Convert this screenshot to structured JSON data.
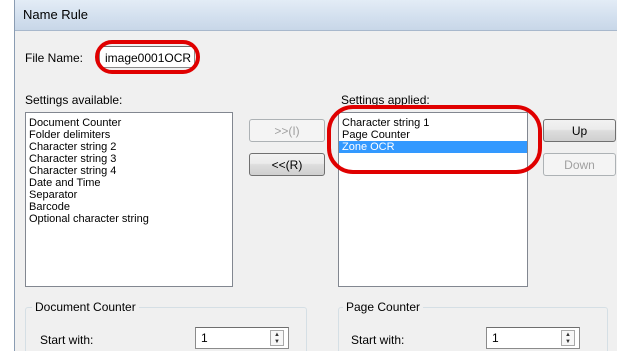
{
  "window": {
    "title": "Name Rule"
  },
  "file_name": {
    "label": "File Name:",
    "value": "image0001OCR"
  },
  "settings_available": {
    "label": "Settings available:",
    "items": [
      "Document Counter",
      "Folder delimiters",
      "Character string 2",
      "Character string 3",
      "Character string 4",
      "Date and Time",
      "Separator",
      "Barcode",
      "Optional character string"
    ]
  },
  "settings_applied": {
    "label": "Settings applied:",
    "items": [
      "Character string 1",
      "Page Counter",
      "Zone OCR"
    ],
    "selected": "Zone OCR"
  },
  "buttons": {
    "add": ">>(I)",
    "remove": "<<(R)",
    "up": "Up",
    "down": "Down"
  },
  "document_counter": {
    "title": "Document Counter",
    "start_label": "Start with:",
    "start_value": "1"
  },
  "page_counter": {
    "title": "Page Counter",
    "start_label": "Start with:",
    "start_value": "1"
  },
  "colors": {
    "highlight": "#e00000",
    "selection": "#3399ff"
  }
}
